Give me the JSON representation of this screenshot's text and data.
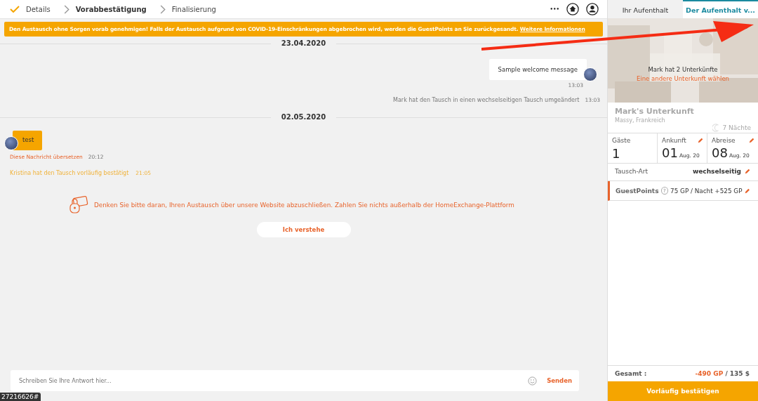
{
  "steps": [
    {
      "label": "Details",
      "done": true,
      "selected": false
    },
    {
      "label": "Vorabbestätigung",
      "done": false,
      "selected": true
    },
    {
      "label": "Finalisierung",
      "done": false,
      "selected": false
    }
  ],
  "toolbar": {
    "more": "•••"
  },
  "banner": {
    "text": "Den Austausch ohne Sorgen vorab genehmigen! Falls der Austausch aufgrund von COVID-19-Einschränkungen abgebrochen wird, werden die GuestPoints an Sie zurückgesandt.",
    "link": "Weitere Informationen"
  },
  "messages": [
    {
      "kind": "date",
      "text": "23.04.2020"
    },
    {
      "kind": "outgoing",
      "text": "Sample welcome message",
      "time": "13:03"
    },
    {
      "kind": "system",
      "text": "Mark hat den Tausch in einen wechselseitigen Tausch umgeändert",
      "time": "13:03"
    },
    {
      "kind": "date",
      "text": "02.05.2020"
    },
    {
      "kind": "incoming",
      "text": "test",
      "translate": "Diese Nachricht übersetzen",
      "time": "20:12"
    },
    {
      "kind": "confirm",
      "text": "Kristina hat den Tausch vorläufig bestätigt",
      "time": "21:05"
    }
  ],
  "notice": {
    "text": "Denken Sie bitte daran, Ihren Austausch über unsere Website abzuschließen. Zahlen Sie nichts außerhalb der HomeExchange-Plattform",
    "button": "Ich verstehe"
  },
  "composer": {
    "placeholder": "Schreiben Sie Ihre Antwort hier...",
    "send": "Senden"
  },
  "url_tooltip": "27216626#",
  "tabs": [
    {
      "label": "Ihr Aufenthalt",
      "selected": false
    },
    {
      "label": "Der Aufenthalt v...",
      "selected": true
    }
  ],
  "home": {
    "kind": "picture",
    "count_text": "Mark hat 2 Unterkünfte",
    "link": "Eine andere Unterkunft wählen",
    "name": "Mark's Unterkunft",
    "location": "Massy, Frankreich",
    "nights": "7 Nächte"
  },
  "details": [
    {
      "label": "Gäste",
      "value": "1",
      "editable": false
    },
    {
      "label": "Ankunft",
      "value": "01",
      "suffix": "Aug. 20",
      "editable": true
    },
    {
      "label": "Abreise",
      "value": "08",
      "suffix": "Aug. 20",
      "editable": true
    }
  ],
  "exchange_type": {
    "label": "Tausch-Art",
    "value": "wechselseitig"
  },
  "guestpoints": {
    "label": "GuestPoints",
    "help": "?",
    "value": "75 GP / Nacht +525 GP"
  },
  "total": {
    "label": "Gesamt :",
    "points": "-490 GP",
    "rest": "/ 135 $"
  },
  "confirm_button": "Vorläufig bestätigen"
}
